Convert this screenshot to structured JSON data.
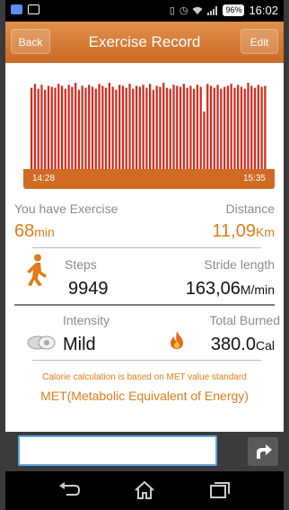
{
  "status_bar": {
    "battery": "96%",
    "time": "16:02",
    "icons": [
      "image-icon",
      "message-icon",
      "vibrate-icon",
      "alarm-icon",
      "wifi-icon",
      "signal-icon",
      "battery-icon"
    ]
  },
  "header": {
    "back_label": "Back",
    "title": "Exercise Record",
    "edit_label": "Edit"
  },
  "chart_data": {
    "type": "bar",
    "color": "#d32b1f",
    "time_start": "14:28",
    "time_end": "15:35",
    "ylim": [
      0,
      100
    ],
    "values": [
      84,
      88,
      83,
      87,
      82,
      86,
      85,
      84,
      88,
      86,
      83,
      87,
      85,
      89,
      82,
      86,
      84,
      87,
      85,
      83,
      88,
      86,
      84,
      89,
      85,
      82,
      87,
      86,
      84,
      88,
      83,
      86,
      85,
      87,
      84,
      88,
      82,
      86,
      85,
      89,
      84,
      83,
      87,
      86,
      85,
      88,
      84,
      86,
      83,
      87,
      85,
      60,
      88,
      86,
      84,
      87,
      83,
      85,
      86,
      88,
      84,
      87,
      85,
      83,
      89,
      86,
      84,
      87,
      85,
      86
    ]
  },
  "stats": {
    "exercise_label": "You have Exercise",
    "exercise_value": "68",
    "exercise_unit": "min",
    "distance_label": "Distance",
    "distance_value": "11,09",
    "distance_unit": "Km",
    "steps_label": "Steps",
    "steps_value": "9949",
    "stride_label": "Stride length",
    "stride_value": "163,06",
    "stride_unit": "M/min",
    "intensity_label": "Intensity",
    "intensity_value": "Mild",
    "burned_label": "Total Burned",
    "burned_value": "380.0",
    "burned_unit": "Cal"
  },
  "notes": {
    "line1": "Calorie calculation is based on MET value standard",
    "line2": "MET(Metabolic Equivalent of Energy)"
  },
  "input": {
    "value": "",
    "placeholder": ""
  },
  "colors": {
    "accent": "#e07b1b",
    "header": "#d9813c",
    "chart_bar": "#d32b1f",
    "time_bar": "#d16a23"
  }
}
